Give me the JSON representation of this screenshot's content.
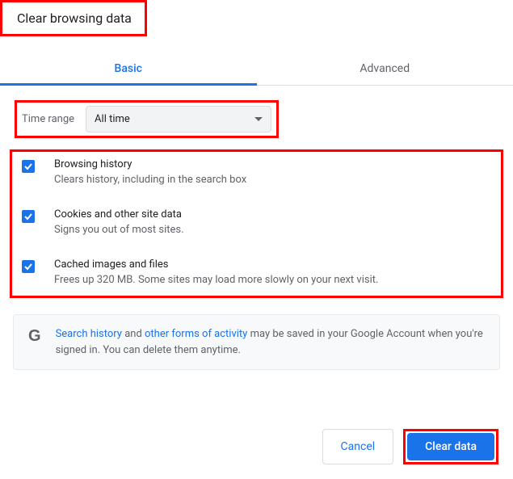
{
  "title": "Clear browsing data",
  "tabs": {
    "basic": "Basic",
    "advanced": "Advanced"
  },
  "time_range": {
    "label": "Time range",
    "selected": "All time"
  },
  "options": [
    {
      "title": "Browsing history",
      "desc": "Clears history, including in the search box",
      "checked": true
    },
    {
      "title": "Cookies and other site data",
      "desc": "Signs you out of most sites.",
      "checked": true
    },
    {
      "title": "Cached images and files",
      "desc": "Frees up 320 MB. Some sites may load more slowly on your next visit.",
      "checked": true
    }
  ],
  "info": {
    "link1": "Search history",
    "mid1": " and ",
    "link2": "other forms of activity",
    "tail": " may be saved in your Google Account when you're signed in. You can delete them anytime."
  },
  "buttons": {
    "cancel": "Cancel",
    "clear": "Clear data"
  }
}
